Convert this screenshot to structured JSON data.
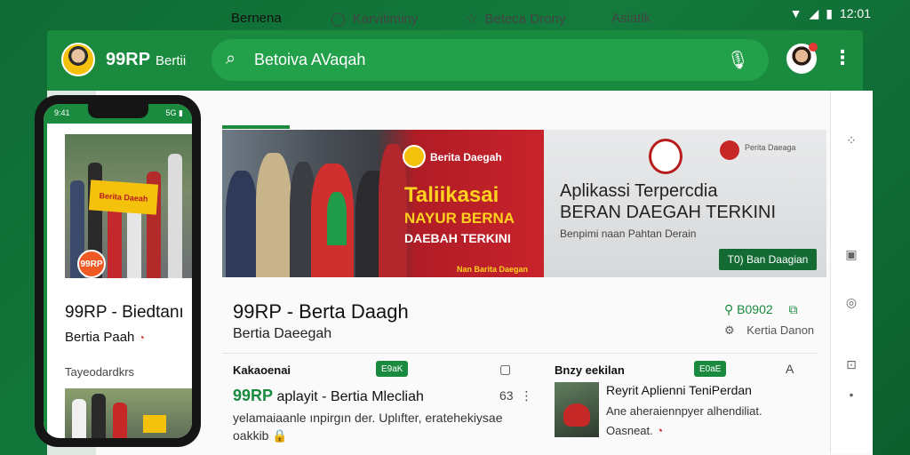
{
  "status": {
    "time": "12:01"
  },
  "appbar": {
    "title": "99RP",
    "subtitle": "Bertii",
    "search_text": "Betoiva AVaqah"
  },
  "tabs": [
    {
      "label": "Bernena"
    },
    {
      "label": "Karvitiminy"
    },
    {
      "label": "Beteca Drony"
    },
    {
      "label": "Asiatik"
    }
  ],
  "banner_left": {
    "brand": "Berita Daegah",
    "headline1": "Taliikasai",
    "headline2": "NAYUR BERNA",
    "headline3": "DAEBAH TERKINI",
    "footer": "Nan Barita Daegan"
  },
  "banner_right": {
    "mini": "Perita Daeaga",
    "title_line1": "Aplikassi Terpercdia",
    "title_line2": "BERAN DAEGAH TERKINI",
    "subtitle": "Benpimi naan Pahtan Derain",
    "button": "T0) Ban Daagian"
  },
  "post": {
    "title": "99RP - Berta Daagh",
    "subtitle": "Bertia Daeegah",
    "stat1": "B0902",
    "stat2": "Kertia Danon"
  },
  "card1": {
    "head": "Kakaoenai",
    "chip": "E9aK",
    "title_green": "99RP",
    "title_rest": "aplayit - Bertia Mlecliah",
    "count": "63",
    "body_line1": "yelamaiaanle ınpirgın der. Uplıfter, eratehekiysae",
    "body_line2": "oakkib"
  },
  "card2": {
    "head": "Bnzy eekilan",
    "chip": "E0aE",
    "title": "Reyrit Aplienni TeniPerdan",
    "body_line1": "Ane aheraiennpyer alhendiliat.",
    "body_line2": "Oasneat."
  },
  "phone": {
    "status_time": "9:41",
    "status_right": "5G ▮",
    "sign": "Berita Daeah",
    "badge": "99RP",
    "title": "99RP - Biedtanı",
    "subtitle": "Bertia Paah",
    "section": "Tayeodardkrs"
  }
}
